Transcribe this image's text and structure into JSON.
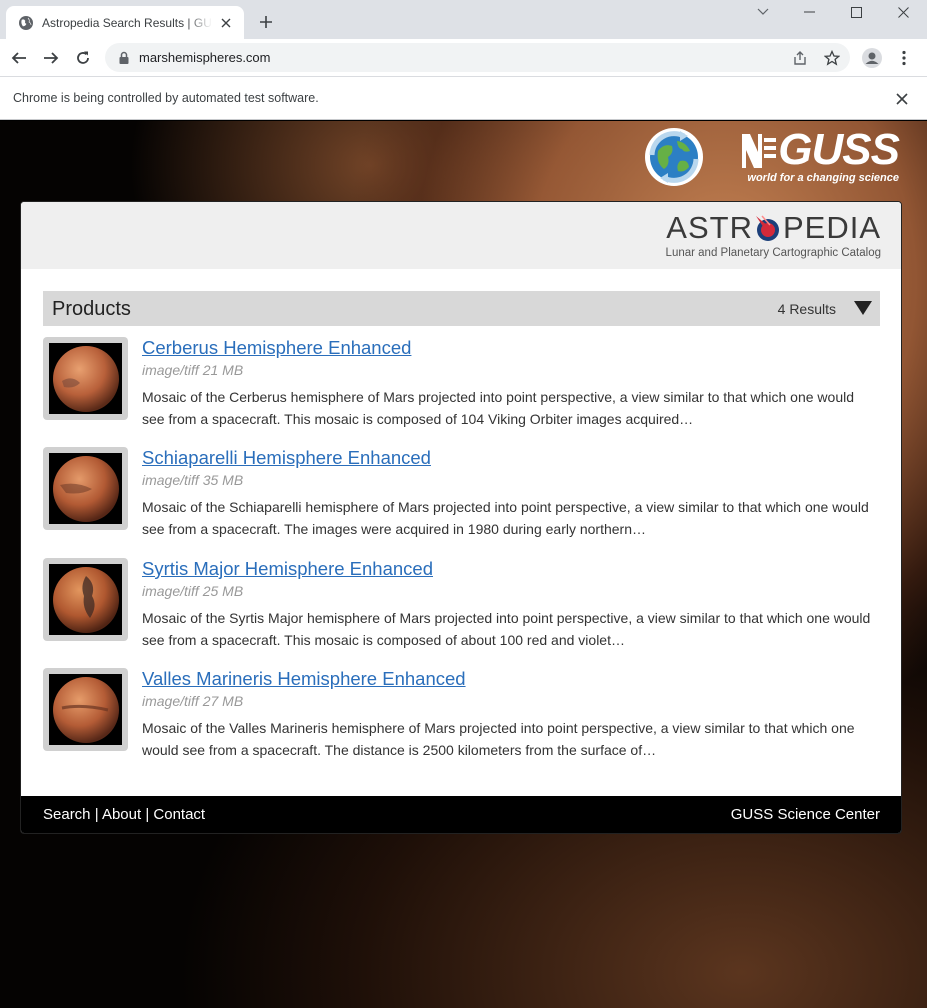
{
  "browser": {
    "tab_title": "Astropedia Search Results | GUSS",
    "url": "marshemispheres.com",
    "infobar_text": "Chrome is being controlled by automated test software."
  },
  "branding": {
    "guss_text": "GUSS",
    "guss_tagline": "world for a changing science",
    "astro_left": "ASTR",
    "astro_right": "PEDIA",
    "astro_subtitle": "Lunar and Planetary Cartographic Catalog"
  },
  "products": {
    "title": "Products",
    "results_count": "4 Results",
    "items": [
      {
        "title": "Cerberus Hemisphere Enhanced",
        "meta": "image/tiff 21 MB",
        "description": "Mosaic of the Cerberus hemisphere of Mars projected into point perspective, a view similar to that which one would see from a spacecraft. This mosaic is composed of 104 Viking Orbiter images acquired…"
      },
      {
        "title": "Schiaparelli Hemisphere Enhanced",
        "meta": "image/tiff 35 MB",
        "description": "Mosaic of the Schiaparelli hemisphere of Mars projected into point perspective, a view similar to that which one would see from a spacecraft. The images were acquired in 1980 during early northern…"
      },
      {
        "title": "Syrtis Major Hemisphere Enhanced",
        "meta": "image/tiff 25 MB",
        "description": "Mosaic of the Syrtis Major hemisphere of Mars projected into point perspective, a view similar to that which one would see from a spacecraft. This mosaic is composed of about 100 red and violet…"
      },
      {
        "title": "Valles Marineris Hemisphere Enhanced",
        "meta": "image/tiff 27 MB",
        "description": "Mosaic of the Valles Marineris hemisphere of Mars projected into point perspective, a view similar to that which one would see from a spacecraft. The distance is 2500 kilometers from the surface of…"
      }
    ]
  },
  "footer": {
    "search": "Search",
    "about": "About",
    "contact": "Contact",
    "separator": "|",
    "right": "GUSS Science Center"
  },
  "colors": {
    "link": "#2a6ebb",
    "products_bar": "#d8d8d8",
    "astro_accent": "#d42a3a"
  }
}
